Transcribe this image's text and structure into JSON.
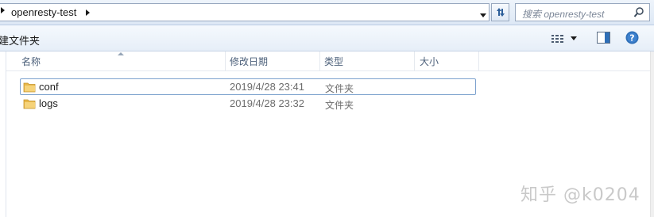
{
  "address_bar": {
    "crumbs": [
      "openresty-test"
    ],
    "refresh_icon": "refresh-icon"
  },
  "search": {
    "placeholder": "搜索 openresty-test",
    "icon": "search-icon"
  },
  "command_bar": {
    "new_folder_label": "建文件夹",
    "views_icon": "details-view-icon",
    "preview_pane_icon": "preview-pane-icon",
    "help_icon": "help-icon"
  },
  "columns": {
    "name": "名称",
    "date": "修改日期",
    "type": "类型",
    "size": "大小"
  },
  "files": [
    {
      "name": "conf",
      "date": "2019/4/28 23:41",
      "type": "文件夹",
      "size": ""
    },
    {
      "name": "logs",
      "date": "2019/4/28 23:32",
      "type": "文件夹",
      "size": ""
    }
  ],
  "watermark": "知乎 @k0204",
  "colors": {
    "accent": "#7da2ce",
    "folder": "#e8b84a",
    "help": "#2f6fb7"
  }
}
